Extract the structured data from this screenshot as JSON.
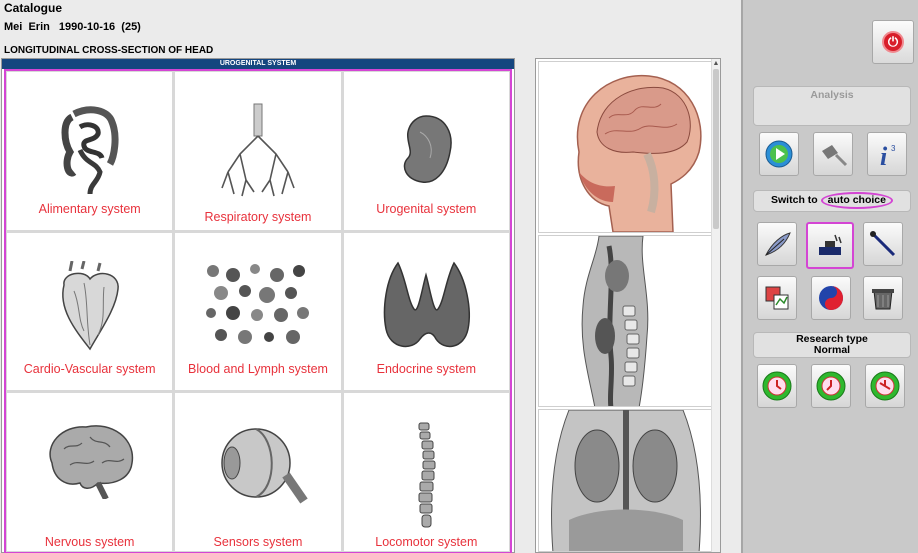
{
  "header": {
    "title": "Catalogue",
    "patient_name": "Mei  Erin",
    "patient_dob_age": "1990-10-16  (25)",
    "section": "LONGITUDINAL CROSS-SECTION OF HEAD"
  },
  "grid": {
    "title": "UROGENITAL SYSTEM",
    "cells": [
      {
        "label": "Alimentary system",
        "icon": "intestine-icon"
      },
      {
        "label": "Respiratory system",
        "icon": "lungs-bronchi-icon"
      },
      {
        "label": "Urogenital system",
        "icon": "kidney-icon"
      },
      {
        "label": "Cardio-Vascular system",
        "icon": "heart-icon"
      },
      {
        "label": "Blood and Lymph system",
        "icon": "blood-cells-icon"
      },
      {
        "label": "Endocrine system",
        "icon": "thyroid-icon"
      },
      {
        "label": "Nervous system",
        "icon": "brain-icon"
      },
      {
        "label": "Sensors system",
        "icon": "eyeball-icon"
      },
      {
        "label": "Locomotor system",
        "icon": "spine-icon"
      }
    ]
  },
  "strip": {
    "images": [
      "head-sagittal-section-image",
      "torso-sagittal-section-image",
      "torso-coronal-section-image"
    ],
    "scroll_up": "▲"
  },
  "sidebar": {
    "power_icon": "power-icon",
    "analysis_label": "Analysis",
    "switch_prefix": "Switch to",
    "switch_choice": "auto choice",
    "research_label": "Research type",
    "research_value": "Normal",
    "colors": {
      "highlight": "#d445d4",
      "label_red": "#e8323c",
      "titlebar": "#15467f"
    }
  }
}
